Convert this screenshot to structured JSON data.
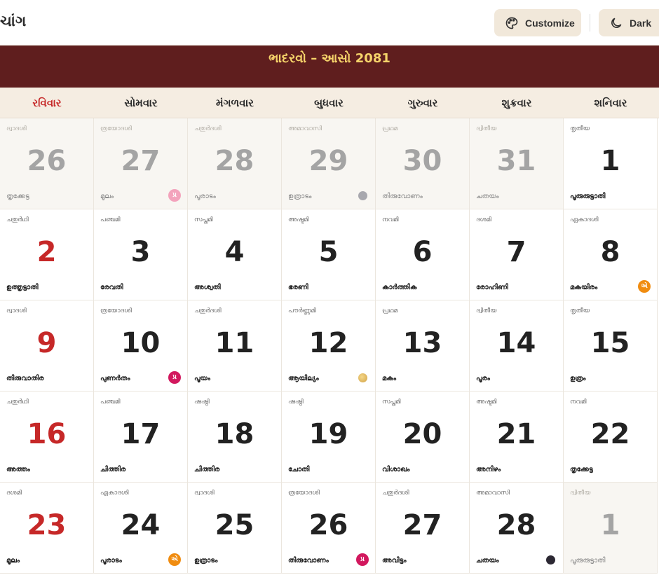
{
  "app": {
    "title": "ચાંગ"
  },
  "toolbar": {
    "customize_label": "Customize",
    "dark_label": "Dark"
  },
  "month": {
    "title": "ભાદરવો – આસો 2081"
  },
  "weekdays": [
    "રવિવાર",
    "સોમવાર",
    "મંગળવાર",
    "બુધવાર",
    "ગુરુવાર",
    "શુક્રવાર",
    "શનિવાર"
  ],
  "weeks": [
    [
      {
        "day": "26",
        "tithi": "ദ്വാദശി",
        "nak": "തൃക്കേട്ട",
        "other": true
      },
      {
        "day": "27",
        "tithi": "ത്രയോദശി",
        "nak": "മൂലം",
        "other": true,
        "badge": "પ્ર",
        "badge_type": "pink"
      },
      {
        "day": "28",
        "tithi": "ചതുർദശി",
        "nak": "പൂരാടം",
        "other": true
      },
      {
        "day": "29",
        "tithi": "അമാവാസി",
        "nak": "ഉത്രാടം",
        "other": true,
        "moon": "newlight"
      },
      {
        "day": "30",
        "tithi": "പ്രഥമ",
        "nak": "തിരുവോണം",
        "other": true
      },
      {
        "day": "31",
        "tithi": "ദ്വിതീയ",
        "nak": "ചതയം",
        "other": true
      },
      {
        "day": "1",
        "tithi": "തൃതീയ",
        "nak": "പൂരുരുട്ടാതി"
      }
    ],
    [
      {
        "day": "2",
        "tithi": "ചതുർഥി",
        "nak": "ഉത്തൃട്ടാതി",
        "sun": true
      },
      {
        "day": "3",
        "tithi": "പഞ്ചമി",
        "nak": "രേവതി"
      },
      {
        "day": "4",
        "tithi": "സപ്തമി",
        "nak": "അശ്വതി"
      },
      {
        "day": "5",
        "tithi": "അഷ്ടമി",
        "nak": "ഭരണി"
      },
      {
        "day": "6",
        "tithi": "നവമി",
        "nak": "കാർത്തിക"
      },
      {
        "day": "7",
        "tithi": "ദശമി",
        "nak": "രോഹിണി"
      },
      {
        "day": "8",
        "tithi": "ഏകാദശി",
        "nak": "മകയിരം",
        "badge": "એ",
        "badge_type": "orange"
      }
    ],
    [
      {
        "day": "9",
        "tithi": "ദ്വാദശി",
        "nak": "തിരുവാതിര",
        "sun": true
      },
      {
        "day": "10",
        "tithi": "ത്രയോദശി",
        "nak": "പുണർതം",
        "badge": "પ્ર",
        "badge_type": "magenta"
      },
      {
        "day": "11",
        "tithi": "ചതുർദശി",
        "nak": "പൂയം"
      },
      {
        "day": "12",
        "tithi": "പൗർണ്ണമി",
        "nak": "ആയില്യം",
        "moon": "full"
      },
      {
        "day": "13",
        "tithi": "പ്രഥമ",
        "nak": "മകം"
      },
      {
        "day": "14",
        "tithi": "ദ്വിതീയ",
        "nak": "പൂരം"
      },
      {
        "day": "15",
        "tithi": "തൃതീയ",
        "nak": "ഉത്രം"
      }
    ],
    [
      {
        "day": "16",
        "tithi": "ചതുർഥി",
        "nak": "അത്തം",
        "sun": true
      },
      {
        "day": "17",
        "tithi": "പഞ്ചമി",
        "nak": "ചിത്തിര"
      },
      {
        "day": "18",
        "tithi": "ഷഷ്ഠി",
        "nak": "ചിത്തിര"
      },
      {
        "day": "19",
        "tithi": "ഷഷ്ഠി",
        "nak": "ചോതി"
      },
      {
        "day": "20",
        "tithi": "സപ്തമി",
        "nak": "വിശാഖം"
      },
      {
        "day": "21",
        "tithi": "അഷ്ടമി",
        "nak": "അനിഴം"
      },
      {
        "day": "22",
        "tithi": "നവമി",
        "nak": "തൃക്കേട്ട"
      }
    ],
    [
      {
        "day": "23",
        "tithi": "ദശമി",
        "nak": "മൂലം",
        "sun": true
      },
      {
        "day": "24",
        "tithi": "ഏകാദശി",
        "nak": "പൂരാടം",
        "badge": "એ",
        "badge_type": "orange"
      },
      {
        "day": "25",
        "tithi": "ദ്വാദശി",
        "nak": "ഉത്രാടം"
      },
      {
        "day": "26",
        "tithi": "ത്രയോദശി",
        "nak": "തിരുവോണം",
        "badge": "પ્ર",
        "badge_type": "magenta"
      },
      {
        "day": "27",
        "tithi": "ചതുർദശി",
        "nak": "അവിട്ടം"
      },
      {
        "day": "28",
        "tithi": "അമാവാസി",
        "nak": "ചതയം",
        "moon": "new"
      },
      {
        "day": "1",
        "tithi": "ദ്വിതീയ",
        "nak": "പൂരുരുട്ടാതി",
        "other": true
      }
    ]
  ]
}
